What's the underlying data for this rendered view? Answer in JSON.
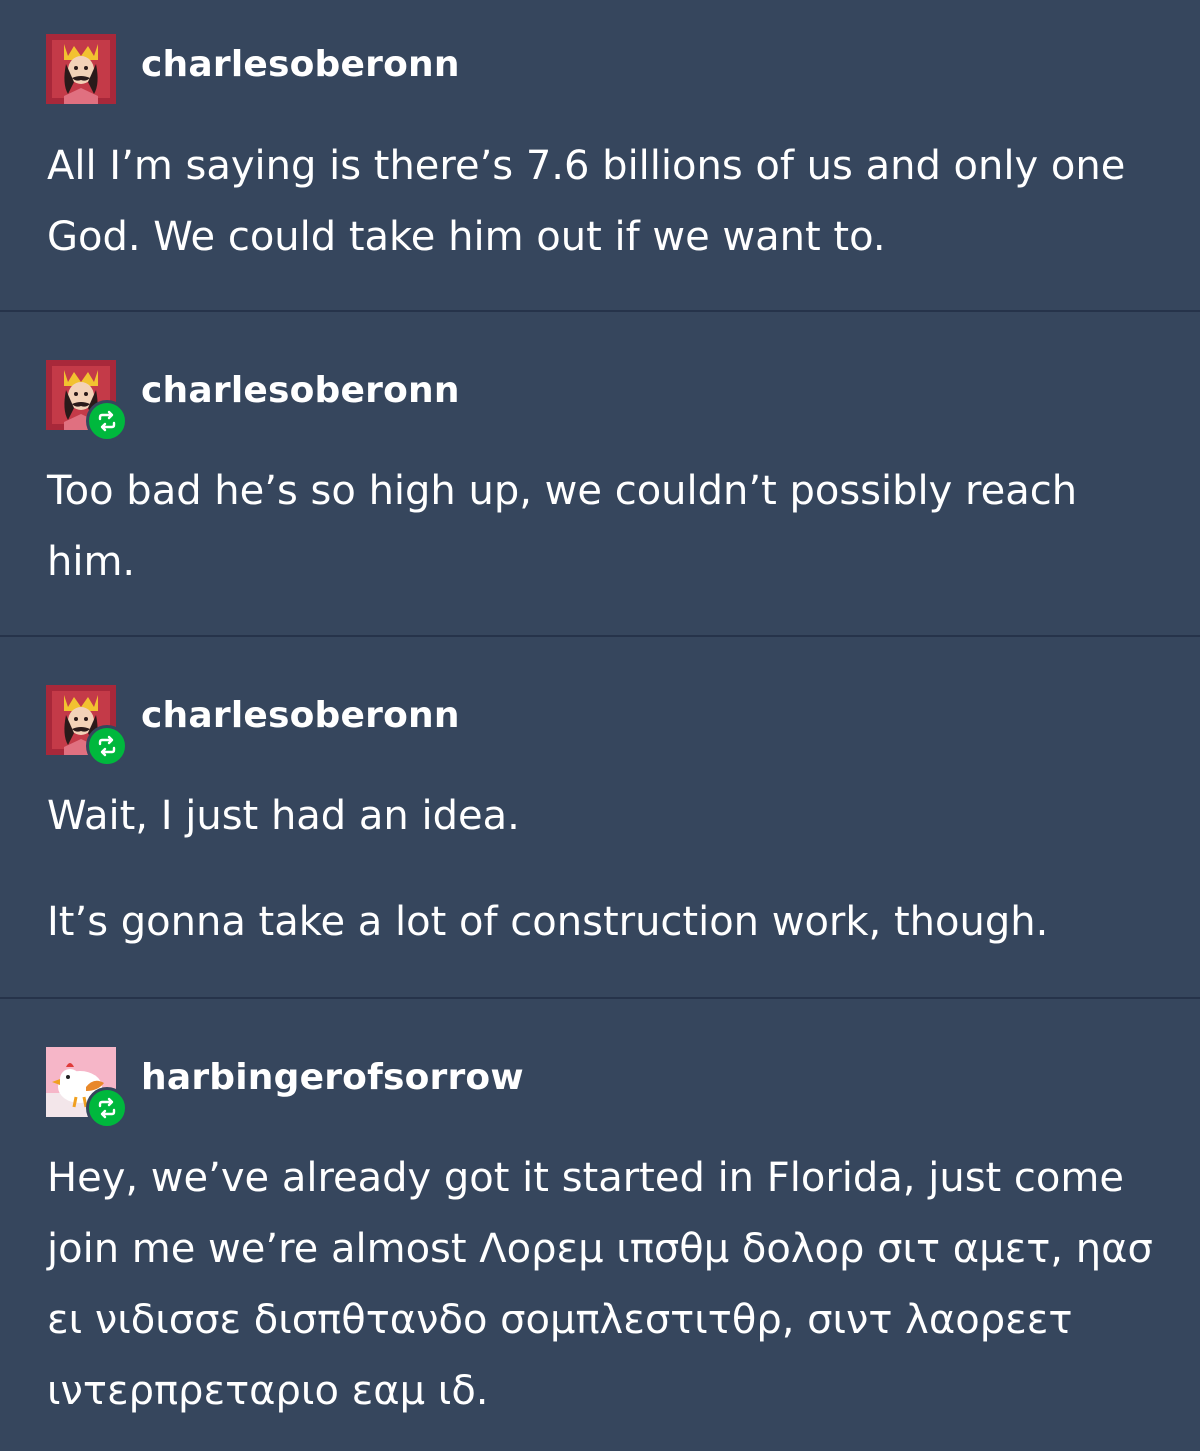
{
  "posts": [
    {
      "username": "charlesoberonn",
      "reblog": false,
      "avatar": "crowned-king-avatar",
      "paragraphs": [
        "All I’m saying is there’s 7.6 billions of us and only one God. We could take him out if we want to."
      ]
    },
    {
      "username": "charlesoberonn",
      "reblog": true,
      "avatar": "crowned-king-avatar",
      "paragraphs": [
        "Too bad he’s so high up, we couldn’t possibly reach him."
      ]
    },
    {
      "username": "charlesoberonn",
      "reblog": true,
      "avatar": "crowned-king-avatar",
      "paragraphs": [
        "Wait, I just had an idea.",
        "It’s gonna take a lot of construction work, though."
      ]
    },
    {
      "username": "harbingerofsorrow",
      "reblog": true,
      "avatar": "cartoon-chicken-avatar",
      "paragraphs": [
        "Hey, we’ve already got it started in Florida, just come join me we’re almost Λορεμ ιπσθμ δολορ σιτ αμετ, ηασ ει νιδισσε δισπθτανδο σομπλεστιτθρ, σιντ λαορεετ ιντερπρεταριο εαμ ιδ."
      ]
    }
  ],
  "colors": {
    "background": "#36465d",
    "divider": "#26334a",
    "reblog_badge": "#00b83d",
    "text": "#ffffff"
  },
  "icons": {
    "reblog": "reblog-icon"
  }
}
